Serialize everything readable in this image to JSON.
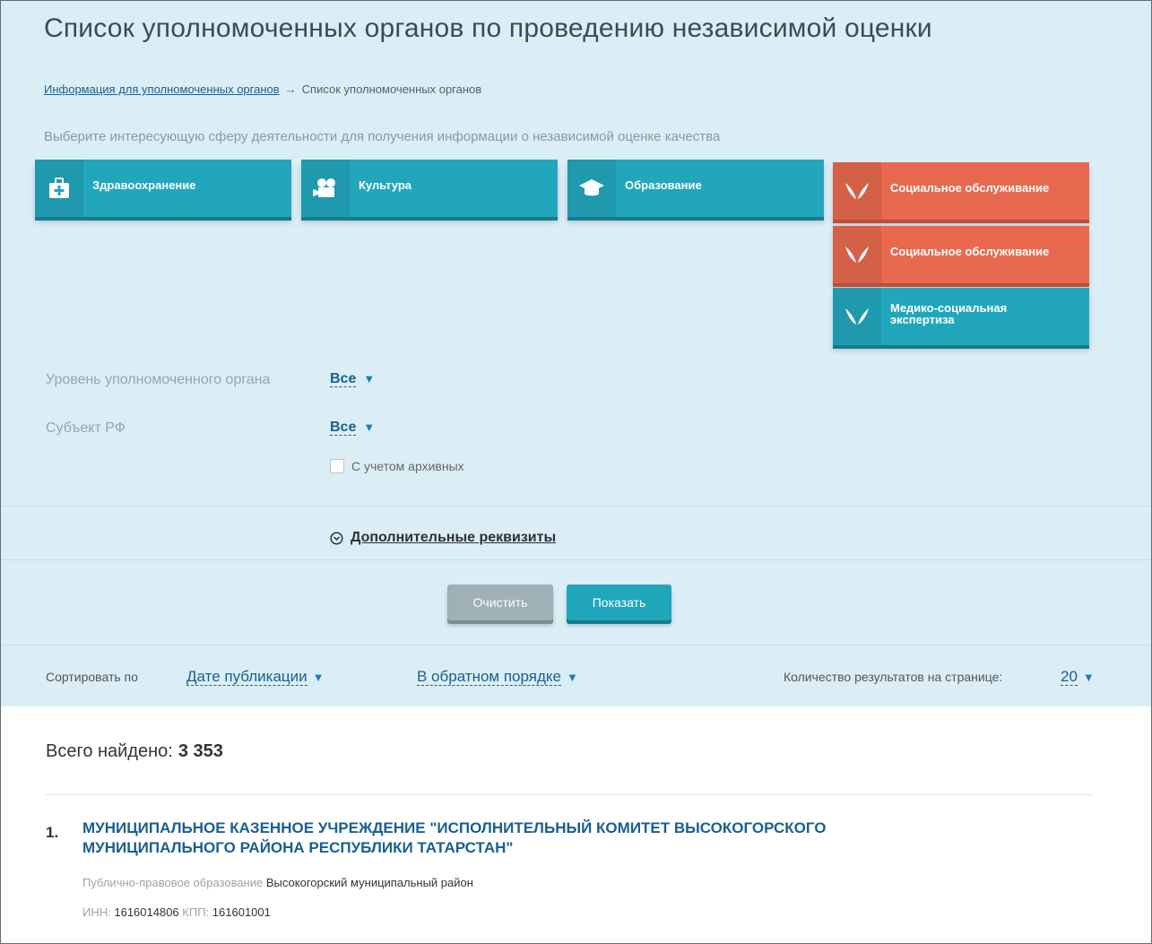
{
  "page": {
    "title": "Список уполномоченных органов по проведению независимой оценки",
    "hint": "Выберите интересующую сферу деятельности для получения информации о независимой оценке качества"
  },
  "breadcrumbs": {
    "link": "Информация для уполномоченных органов",
    "separator": "→",
    "current": "Список уполномоченных органов"
  },
  "spheres": [
    {
      "label": "Здравоохранение",
      "icon": "medical-kit-icon",
      "color": "#22a6bc"
    },
    {
      "label": "Культура",
      "icon": "film-camera-icon",
      "color": "#22a6bc"
    },
    {
      "label": "Образование",
      "icon": "graduation-cap-icon",
      "color": "#22a6bc"
    },
    {
      "label": "Социальное обслуживание",
      "icon": "hands-icon",
      "color": "#e8694f"
    },
    {
      "label": "Социальное обслуживание",
      "icon": "hands-icon",
      "color": "#e8694f"
    },
    {
      "label": "Медико-социальная экспертиза",
      "icon": "hands-icon",
      "color": "#22a6bc"
    }
  ],
  "filters": {
    "level": {
      "label": "Уровень уполномоченного органа",
      "value": "Все"
    },
    "subject": {
      "label": "Субъект РФ",
      "value": "Все"
    },
    "archive": {
      "label": "С учетом архивных",
      "checked": false
    }
  },
  "extra": {
    "label": "Дополнительные реквизиты"
  },
  "buttons": {
    "clear": "Очистить",
    "show": "Показать"
  },
  "sort": {
    "label": "Сортировать по",
    "field": "Дате публикации",
    "order": "В обратном порядке",
    "per_page_label": "Количество результатов на странице:",
    "per_page": "20"
  },
  "results": {
    "found_label": "Всего найдено:",
    "found_count": "3 353",
    "items": [
      {
        "num": "1.",
        "title": "МУНИЦИПАЛЬНОЕ КАЗЕННОЕ УЧРЕЖДЕНИЕ \"ИСПОЛНИТЕЛЬНЫЙ КОМИТЕТ ВЫСОКОГОРСКОГО МУНИЦИПАЛЬНОГО РАЙОНА РЕСПУБЛИКИ ТАТАРСТАН\"",
        "ppo_label": "Публично-правовое образование",
        "ppo_value": "Высокогорский муниципальный район",
        "inn_label": "ИНН:",
        "inn": "1616014806",
        "kpp_label": "КПП:",
        "kpp": "161601001"
      }
    ]
  },
  "colors": {
    "teal": "#22a6bc",
    "orange": "#e8694f",
    "panel": "#dbeef6",
    "link": "#1a5f8c"
  }
}
